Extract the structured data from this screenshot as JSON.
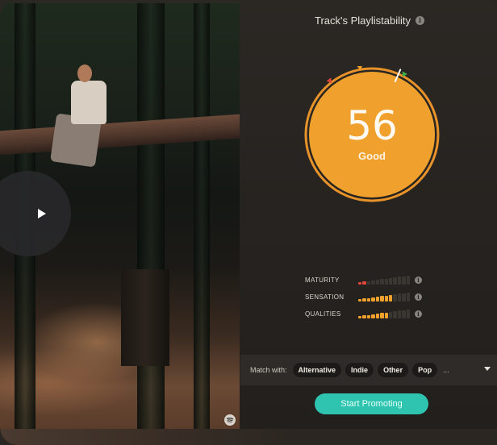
{
  "header": {
    "title": "Track's Playlistability",
    "info_glyph": "i"
  },
  "score": {
    "value": "56",
    "label": "Good",
    "percent": 56,
    "colors": {
      "fill": "#f0a02c",
      "ring": "#e8922a",
      "low": "#e0463a",
      "mid": "#f0a02c",
      "high": "#3bb04a"
    }
  },
  "metrics": [
    {
      "label": "MATURITY",
      "level": 2,
      "total": 12,
      "color": "#e0463a"
    },
    {
      "label": "SENSATION",
      "level": 8,
      "total": 12,
      "color": "#f0a02c"
    },
    {
      "label": "QUALITIES",
      "level": 7,
      "total": 12,
      "color": "#f0a02c"
    }
  ],
  "match": {
    "label": "Match with:",
    "chips": [
      "Alternative",
      "Indie",
      "Other",
      "Pop"
    ],
    "more": "..."
  },
  "cta": {
    "label": "Start Promoting",
    "color": "#2ec4b0"
  },
  "icons": {
    "play": "play-icon",
    "spotify": "spotify-icon",
    "info": "info-icon",
    "dropdown": "chevron-down-icon"
  }
}
